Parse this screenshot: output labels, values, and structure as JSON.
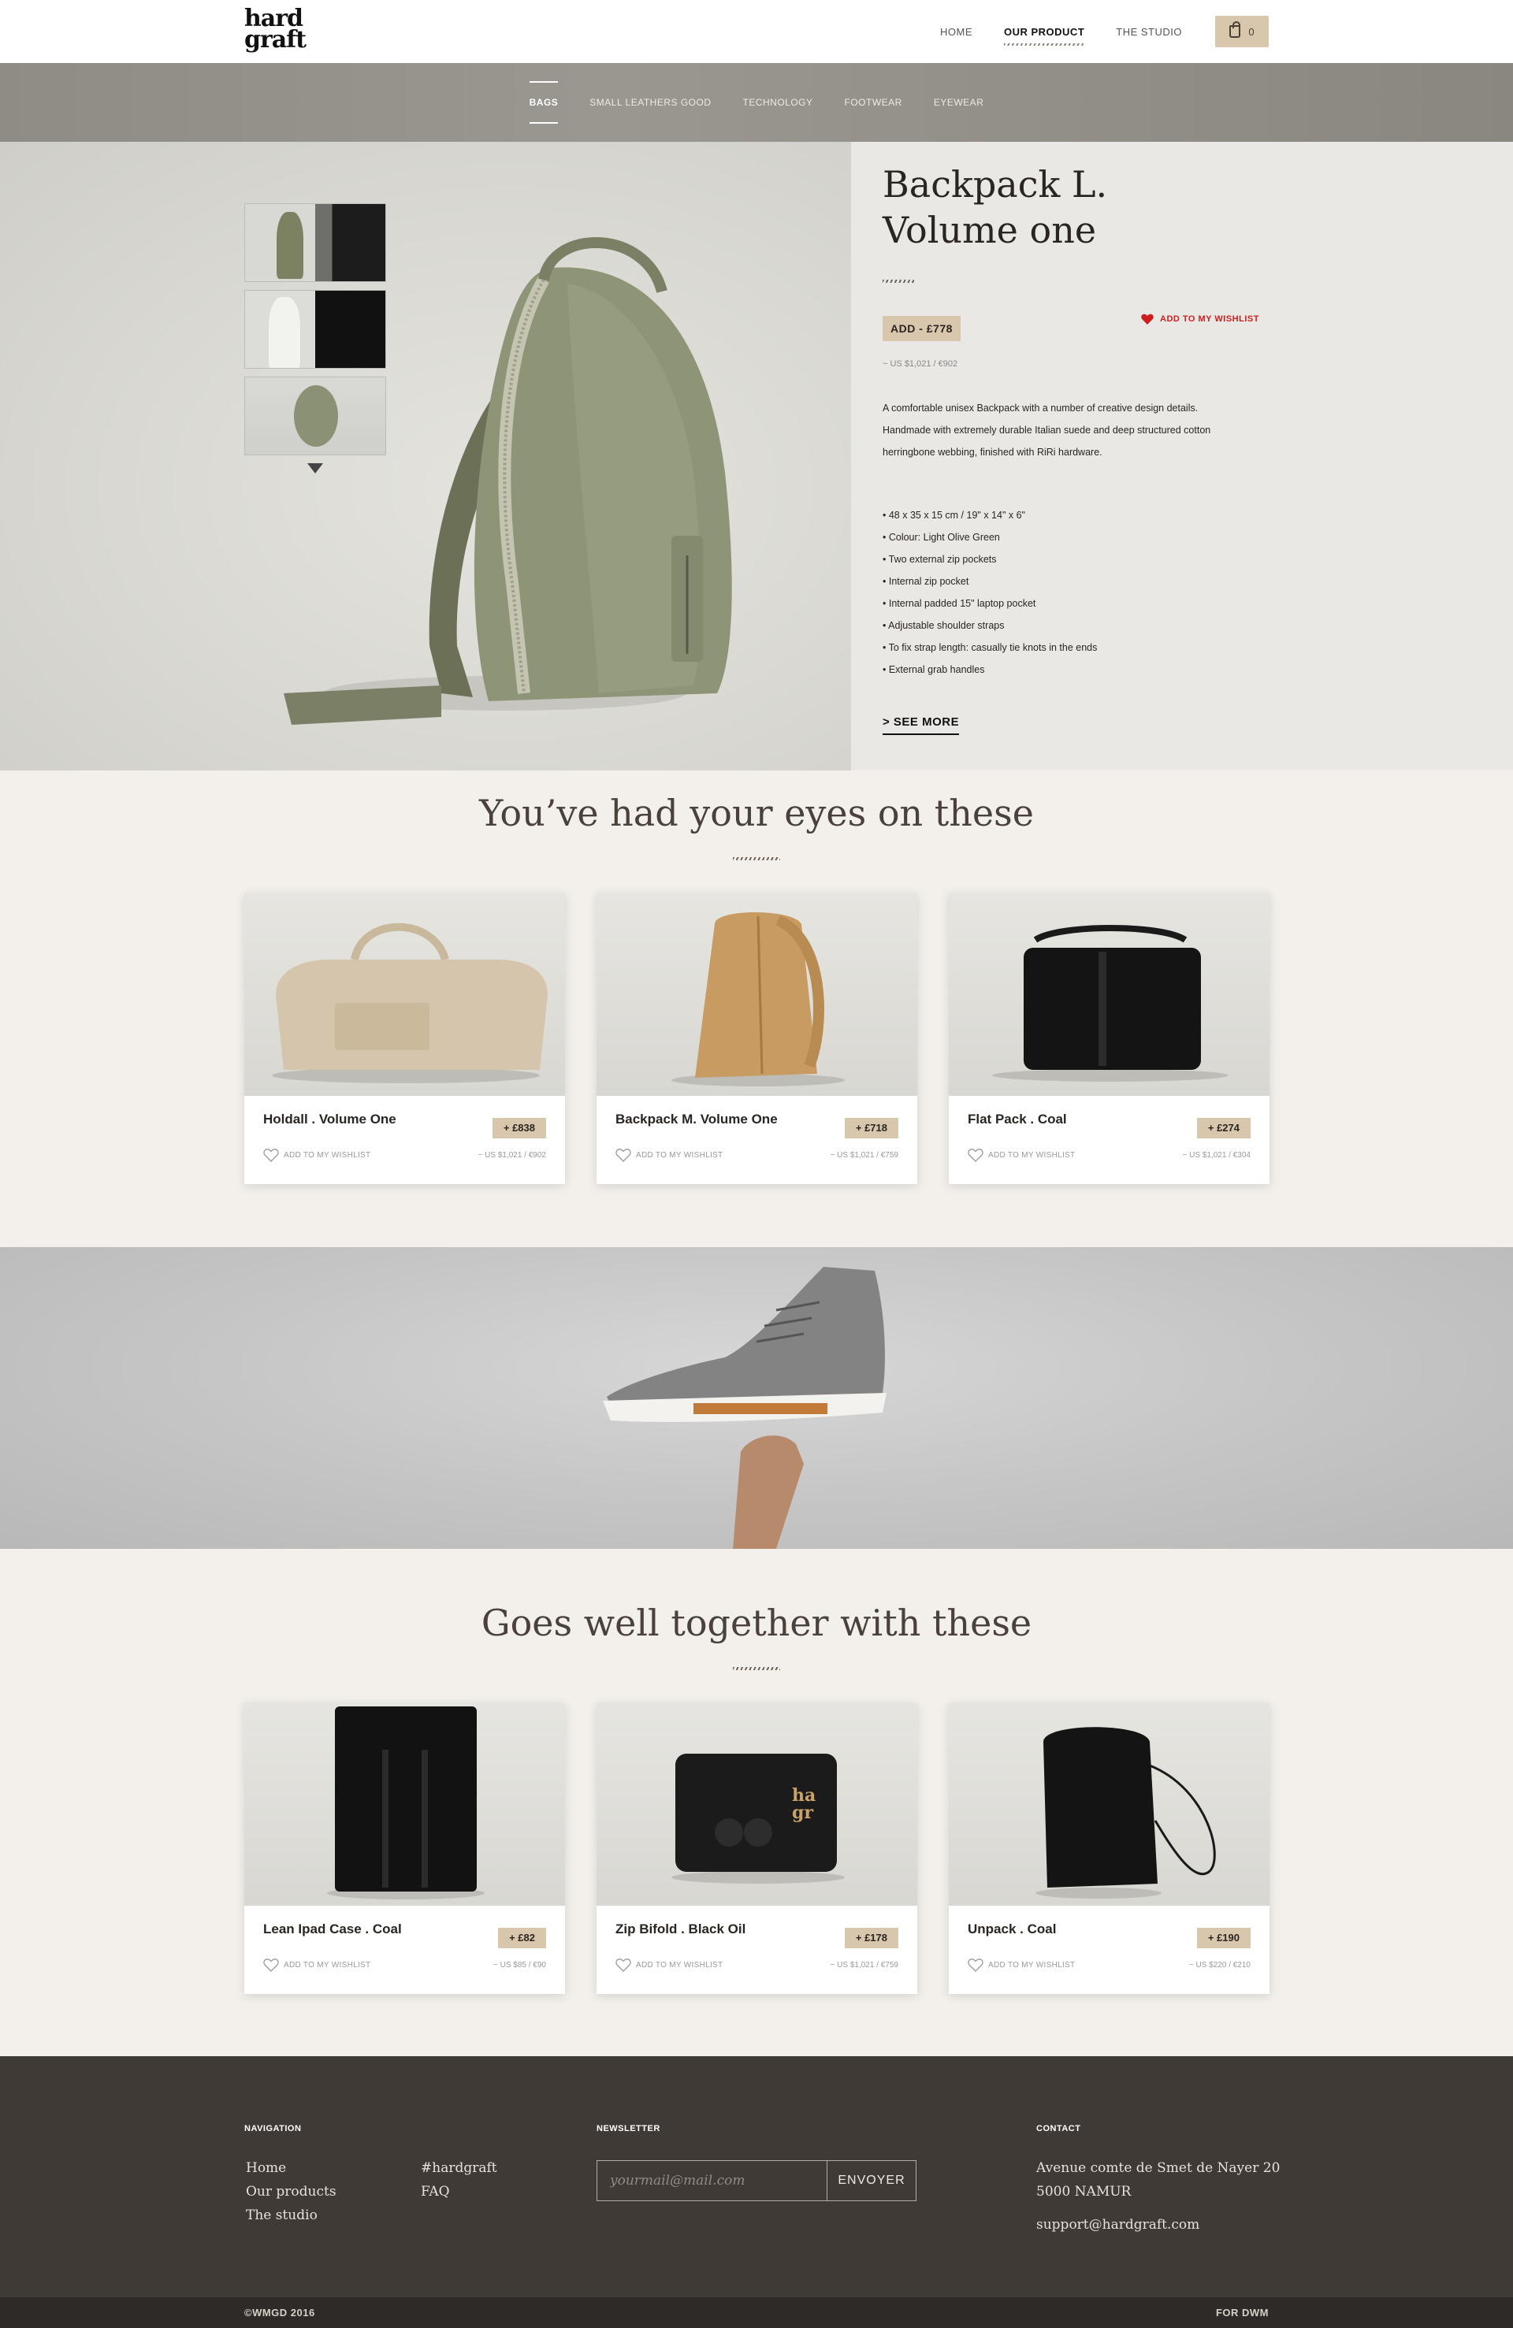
{
  "brand": {
    "logo_line1": "hard",
    "logo_line2": "graft"
  },
  "header": {
    "nav": [
      "HOME",
      "OUR PRODUCT",
      "THE STUDIO"
    ],
    "cart_count": "0"
  },
  "subnav": [
    "BAGS",
    "SMALL LEATHERS GOOD",
    "TECHNOLOGY",
    "FOOTWEAR",
    "EYEWEAR"
  ],
  "product": {
    "title": "Backpack L. Volume one",
    "price_button": "ADD - £778",
    "wishlist": "ADD TO MY WISHLIST",
    "alt_price": "~ US $1,021 / €902",
    "description": "A comfortable unisex Backpack with a number of creative design details. Handmade with extremely durable Italian suede and deep structured cotton herringbone webbing, finished with RiRi hardware.",
    "features": [
      "• 48 x 35 x 15 cm / 19\" x 14\" x 6\"",
      "• Colour: Light Olive Green",
      "• Two external zip pockets",
      "• Internal zip pocket",
      "• Internal padded 15\" laptop pocket",
      "• Adjustable shoulder straps",
      "• To fix strap length: casually tie knots in the ends",
      "• External grab handles"
    ],
    "see_more": "> SEE MORE"
  },
  "section1": {
    "title": "You’ve had your eyes on these",
    "cards": [
      {
        "name": "Holdall . Volume One",
        "price": "+ £838",
        "wish": "ADD TO MY WISHLIST",
        "alt": "~ US $1,021 / €902"
      },
      {
        "name": "Backpack M. Volume One",
        "price": "+ £718",
        "wish": "ADD TO MY WISHLIST",
        "alt": "~ US $1,021 / €759"
      },
      {
        "name": "Flat Pack . Coal",
        "price": "+ £274",
        "wish": "ADD TO MY WISHLIST",
        "alt": "~ US $1,021 / €304"
      }
    ]
  },
  "section2": {
    "title": "Goes well together with these",
    "cards": [
      {
        "name": "Lean Ipad Case . Coal",
        "price": "+ £82",
        "wish": "ADD TO MY WISHLIST",
        "alt": "~ US $85 / €90"
      },
      {
        "name": "Zip Bifold . Black Oil",
        "price": "+ £178",
        "wish": "ADD TO MY WISHLIST",
        "alt": "~ US $1,021 / €759"
      },
      {
        "name": "Unpack . Coal",
        "price": "+ £190",
        "wish": "ADD TO MY WISHLIST",
        "alt": "~ US $220 / €210"
      }
    ]
  },
  "footer": {
    "navigation_head": "NAVIGATION",
    "nav_col1": [
      "Home",
      "Our products",
      "The studio"
    ],
    "nav_col2": [
      "#hardgraft",
      "FAQ"
    ],
    "newsletter_head": "NEWSLETTER",
    "newsletter_placeholder": "yourmail@mail.com",
    "newsletter_button": "ENVOYER",
    "contact_head": "CONTACT",
    "address1": "Avenue comte de Smet de Nayer 20",
    "address2": "5000 NAMUR",
    "email": "support@hardgraft.com",
    "copyright": "©WMGD 2016",
    "credit": "FOR DWM"
  },
  "colors": {
    "accent": "#d9c7ad",
    "wishlist_red": "#d01d1d",
    "footer": "#403a37"
  }
}
